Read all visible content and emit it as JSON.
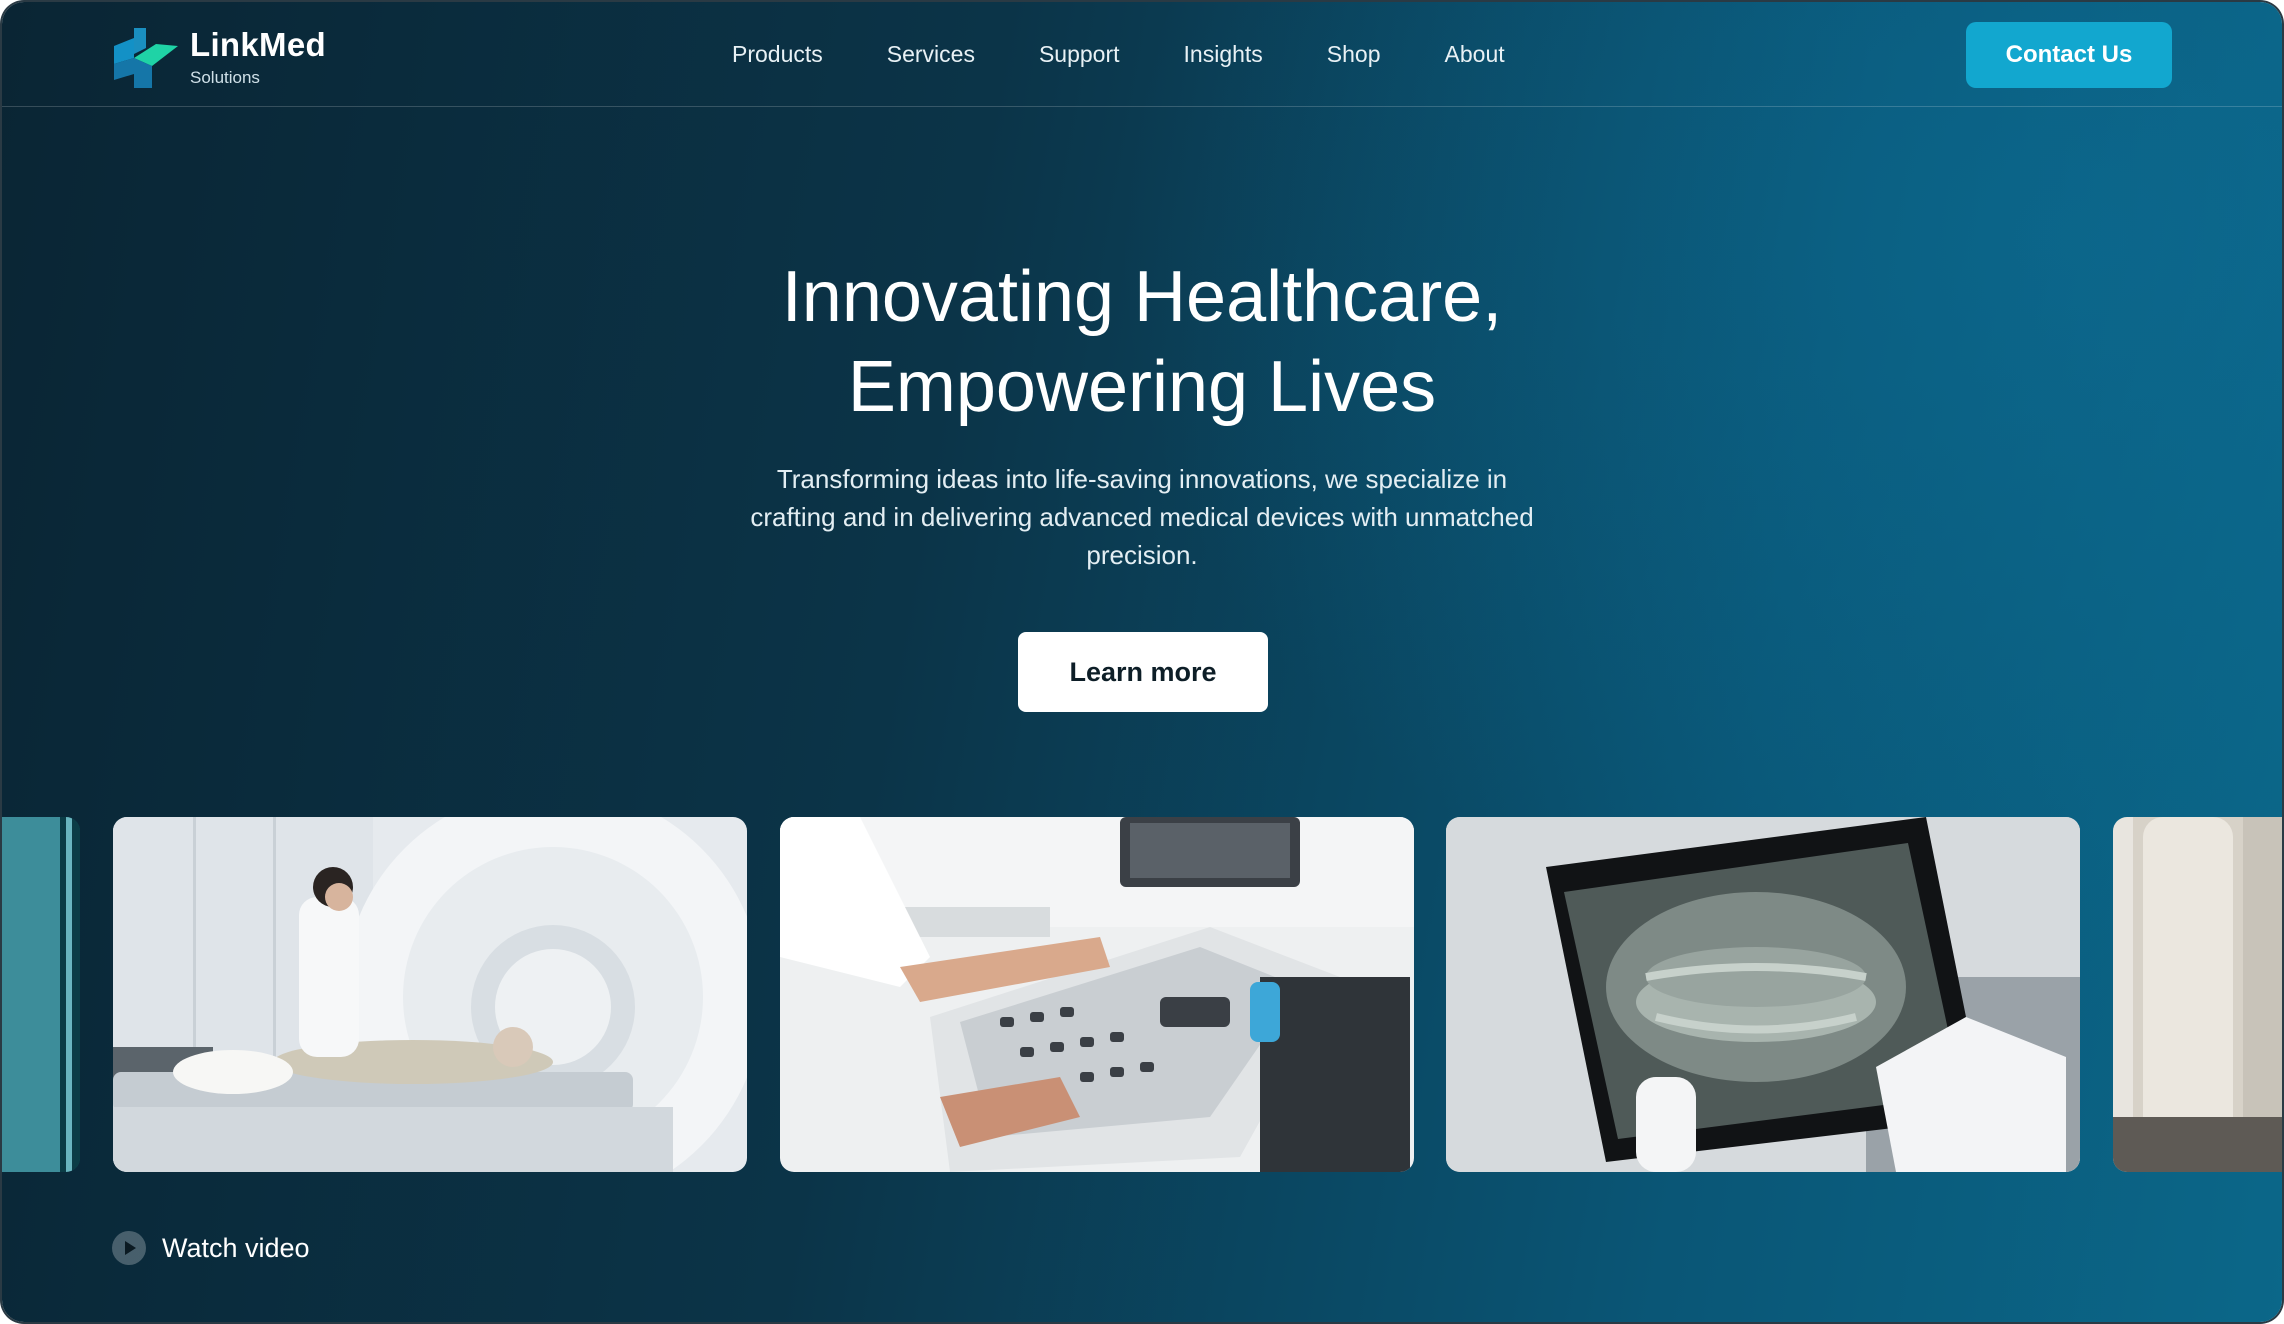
{
  "brand": {
    "name": "LinkMed",
    "tagline": "Solutions"
  },
  "nav": {
    "items": [
      "Products",
      "Services",
      "Support",
      "Insights",
      "Shop",
      "About"
    ]
  },
  "header": {
    "contact_label": "Contact Us"
  },
  "hero": {
    "title_line1": "Innovating Healthcare,",
    "title_line2": "Empowering Lives",
    "description": "Transforming ideas into life-saving innovations, we specialize in crafting and in delivering advanced medical devices with unmatched precision.",
    "cta_label": "Learn more"
  },
  "gallery": {
    "images": [
      "mri-scanner-photo",
      "ultrasound-console-photo",
      "dental-xray-tablet-photo"
    ]
  },
  "video": {
    "label": "Watch video"
  },
  "colors": {
    "accent": "#12a7cf",
    "background_dark": "#0a2534",
    "background_light": "#0b6789",
    "logo_blue": "#1a8fc0",
    "logo_green": "#1fd3a6"
  }
}
